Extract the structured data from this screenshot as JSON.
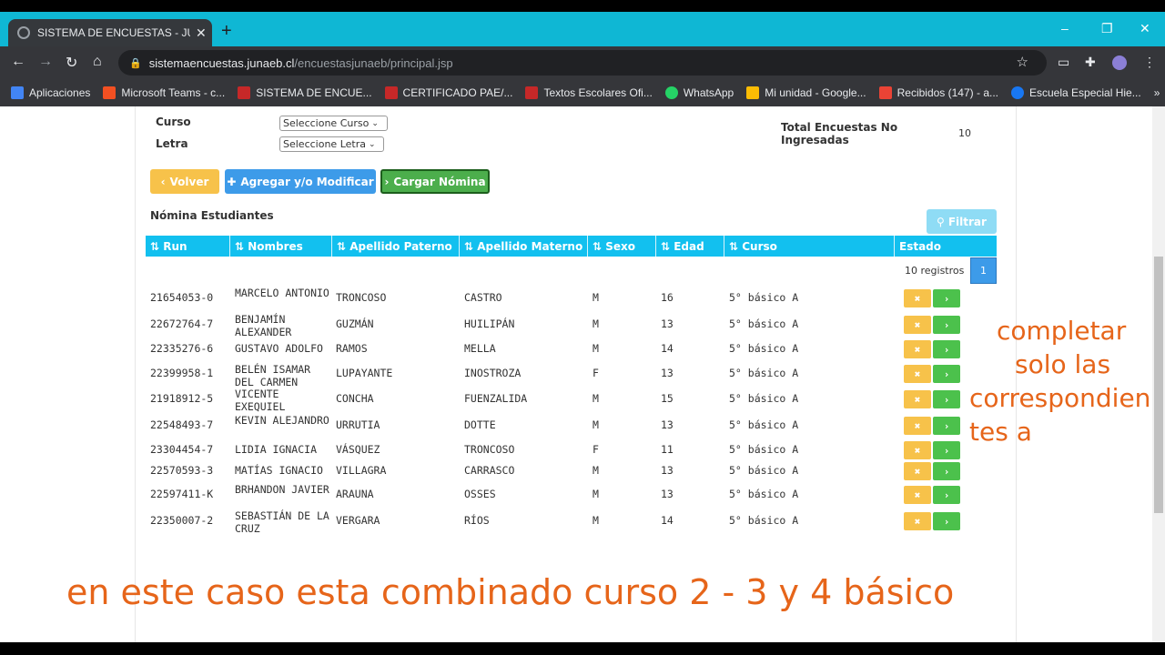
{
  "browser": {
    "tab_title": "SISTEMA DE ENCUESTAS - JUNAEB",
    "new_tab": "+",
    "window_controls": [
      "–",
      "❐",
      "✕"
    ],
    "url_host": "sistemaencuestas.junaeb.cl",
    "url_path": "/encuestasjunaeb/principal.jsp",
    "bookmarks": [
      {
        "label": "Aplicaciones",
        "color": "#4285f4"
      },
      {
        "label": "Microsoft Teams - c...",
        "color": "#f25022"
      },
      {
        "label": "SISTEMA DE ENCUE...",
        "color": "#c62828"
      },
      {
        "label": "CERTIFICADO PAE/...",
        "color": "#c62828"
      },
      {
        "label": "Textos Escolares Ofi...",
        "color": "#c62828"
      },
      {
        "label": "WhatsApp",
        "color": "#25d366"
      },
      {
        "label": "Mi unidad - Google...",
        "color": "#fbbc04"
      },
      {
        "label": "Recibidos (147) - a...",
        "color": "#ea4335"
      },
      {
        "label": "Escuela Especial Hie...",
        "color": "#1877f2"
      }
    ],
    "bookmarks_more": "»"
  },
  "form": {
    "curso_label": "Curso",
    "curso_value": "Seleccione Curso",
    "letra_label": "Letra",
    "letra_value": "Seleccione Letra",
    "total_label": "Total Encuestas No Ingresadas",
    "total_value": "10"
  },
  "buttons": {
    "volver": "Volver",
    "agregar": "Agregar y/o Modificar",
    "cargar": "Cargar Nómina",
    "filtrar": "Filtrar"
  },
  "table": {
    "title": "Nómina Estudiantes",
    "headers": [
      "Run",
      "Nombres",
      "Apellido Paterno",
      "Apellido Materno",
      "Sexo",
      "Edad",
      "Curso",
      "Estado"
    ],
    "registros": "10 registros",
    "page": "1",
    "rows": [
      {
        "run": "21654053-0",
        "nombres": "MARCELO ANTONIO",
        "paterno": "TRONCOSO",
        "materno": "CASTRO",
        "sexo": "M",
        "edad": "16",
        "curso": "5° básico A"
      },
      {
        "run": "22672764-7",
        "nombres": "BENJAMÍN ALEXANDER",
        "paterno": "GUZMÁN",
        "materno": "HUILIPÁN",
        "sexo": "M",
        "edad": "13",
        "curso": "5° básico A"
      },
      {
        "run": "22335276-6",
        "nombres": "GUSTAVO ADOLFO",
        "paterno": "RAMOS",
        "materno": "MELLA",
        "sexo": "M",
        "edad": "14",
        "curso": "5° básico A"
      },
      {
        "run": "22399958-1",
        "nombres": "BELÉN ISAMAR DEL CARMEN",
        "paterno": "LUPAYANTE",
        "materno": "INOSTROZA",
        "sexo": "F",
        "edad": "13",
        "curso": "5° básico A"
      },
      {
        "run": "21918912-5",
        "nombres": "VICENTE EXEQUIEL",
        "paterno": "CONCHA",
        "materno": "FUENZALIDA",
        "sexo": "M",
        "edad": "15",
        "curso": "5° básico A"
      },
      {
        "run": "22548493-7",
        "nombres": "KEVIN ALEJANDRO",
        "paterno": "URRUTIA",
        "materno": "DOTTE",
        "sexo": "M",
        "edad": "13",
        "curso": "5° básico A"
      },
      {
        "run": "23304454-7",
        "nombres": "LIDIA IGNACIA",
        "paterno": "VÁSQUEZ",
        "materno": "TRONCOSO",
        "sexo": "F",
        "edad": "11",
        "curso": "5° básico A"
      },
      {
        "run": "22570593-3",
        "nombres": "MATÍAS IGNACIO",
        "paterno": "VILLAGRA",
        "materno": "CARRASCO",
        "sexo": "M",
        "edad": "13",
        "curso": "5° básico A"
      },
      {
        "run": "22597411-K",
        "nombres": "BRHANDON JAVIER",
        "paterno": "ARAUNA",
        "materno": "OSSES",
        "sexo": "M",
        "edad": "13",
        "curso": "5° básico A"
      },
      {
        "run": "22350007-2",
        "nombres": "SEBASTIÁN DE LA CRUZ",
        "paterno": "VERGARA",
        "materno": "RÍOS",
        "sexo": "M",
        "edad": "14",
        "curso": "5° básico A"
      }
    ]
  },
  "annotations": {
    "side": [
      "completar",
      "solo las",
      "correspondien",
      "tes a"
    ],
    "bottom": "en este caso esta combinado curso 2 - 3 y 4 básico"
  },
  "colors": {
    "volver": "#f7c24a",
    "agregar": "#3d9be9",
    "cargar": "#4cae4c",
    "filtrar": "#8fdcf5",
    "header": "#12c0ef",
    "delete_btn": "#f7c24a",
    "go_btn": "#4cc14c",
    "annotation": "#e6651a"
  }
}
